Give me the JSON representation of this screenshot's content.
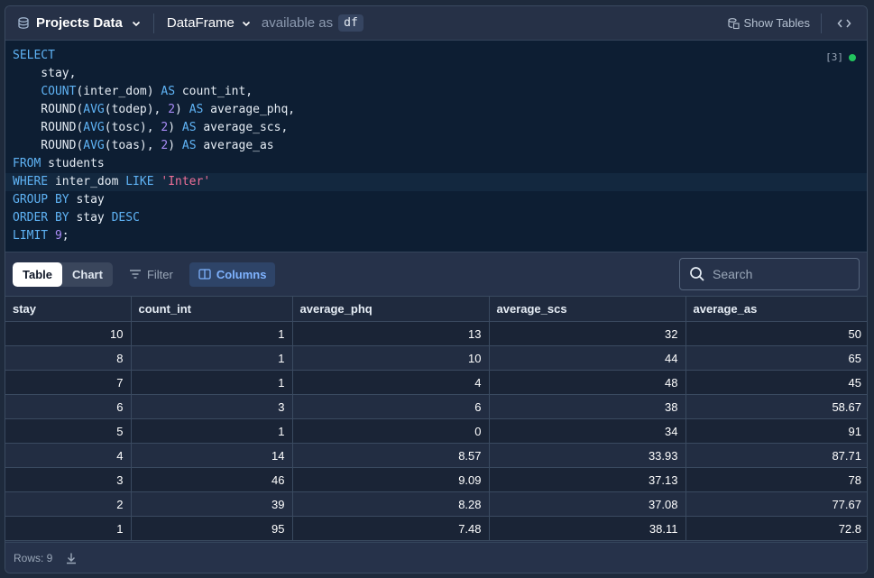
{
  "topbar": {
    "db_label": "Projects Data",
    "df_label": "DataFrame",
    "available_label": "available as",
    "df_name": "df",
    "show_tables_label": "Show Tables"
  },
  "editor": {
    "exec_count": "[3]",
    "status_color": "#22c55e",
    "lines": [
      [
        {
          "t": "SELECT",
          "c": "kw"
        }
      ],
      [
        {
          "t": "    stay,",
          "c": ""
        }
      ],
      [
        {
          "t": "    ",
          "c": ""
        },
        {
          "t": "COUNT",
          "c": "fn"
        },
        {
          "t": "(inter_dom) ",
          "c": ""
        },
        {
          "t": "AS",
          "c": "kw"
        },
        {
          "t": " count_int,",
          "c": ""
        }
      ],
      [
        {
          "t": "    ROUND(",
          "c": ""
        },
        {
          "t": "AVG",
          "c": "fn"
        },
        {
          "t": "(todep), ",
          "c": ""
        },
        {
          "t": "2",
          "c": "num"
        },
        {
          "t": ") ",
          "c": ""
        },
        {
          "t": "AS",
          "c": "kw"
        },
        {
          "t": " average_phq,",
          "c": ""
        }
      ],
      [
        {
          "t": "    ROUND(",
          "c": ""
        },
        {
          "t": "AVG",
          "c": "fn"
        },
        {
          "t": "(tosc), ",
          "c": ""
        },
        {
          "t": "2",
          "c": "num"
        },
        {
          "t": ") ",
          "c": ""
        },
        {
          "t": "AS",
          "c": "kw"
        },
        {
          "t": " average_scs,",
          "c": ""
        }
      ],
      [
        {
          "t": "    ROUND(",
          "c": ""
        },
        {
          "t": "AVG",
          "c": "fn"
        },
        {
          "t": "(toas), ",
          "c": ""
        },
        {
          "t": "2",
          "c": "num"
        },
        {
          "t": ") ",
          "c": ""
        },
        {
          "t": "AS",
          "c": "kw"
        },
        {
          "t": " average_as",
          "c": ""
        }
      ],
      [
        {
          "t": "FROM",
          "c": "kw"
        },
        {
          "t": " students",
          "c": ""
        }
      ],
      [
        {
          "t": "WHERE",
          "c": "kw"
        },
        {
          "t": " inter_dom ",
          "c": ""
        },
        {
          "t": "LIKE",
          "c": "kw"
        },
        {
          "t": " ",
          "c": ""
        },
        {
          "t": "'Inter'",
          "c": "str"
        }
      ],
      [
        {
          "t": "GROUP BY",
          "c": "kw"
        },
        {
          "t": " stay",
          "c": ""
        }
      ],
      [
        {
          "t": "ORDER BY",
          "c": "kw"
        },
        {
          "t": " stay ",
          "c": ""
        },
        {
          "t": "DESC",
          "c": "kw"
        }
      ],
      [
        {
          "t": "LIMIT",
          "c": "kw"
        },
        {
          "t": " ",
          "c": ""
        },
        {
          "t": "9",
          "c": "num"
        },
        {
          "t": ";",
          "c": ""
        }
      ]
    ]
  },
  "toolbar": {
    "table_label": "Table",
    "chart_label": "Chart",
    "filter_label": "Filter",
    "columns_label": "Columns",
    "search_placeholder": "Search"
  },
  "table": {
    "columns": [
      "stay",
      "count_int",
      "average_phq",
      "average_scs",
      "average_as"
    ],
    "rows": [
      [
        "10",
        "1",
        "13",
        "32",
        "50"
      ],
      [
        "8",
        "1",
        "10",
        "44",
        "65"
      ],
      [
        "7",
        "1",
        "4",
        "48",
        "45"
      ],
      [
        "6",
        "3",
        "6",
        "38",
        "58.67"
      ],
      [
        "5",
        "1",
        "0",
        "34",
        "91"
      ],
      [
        "4",
        "14",
        "8.57",
        "33.93",
        "87.71"
      ],
      [
        "3",
        "46",
        "9.09",
        "37.13",
        "78"
      ],
      [
        "2",
        "39",
        "8.28",
        "37.08",
        "77.67"
      ],
      [
        "1",
        "95",
        "7.48",
        "38.11",
        "72.8"
      ]
    ]
  },
  "footer": {
    "rows_label": "Rows: 9"
  }
}
